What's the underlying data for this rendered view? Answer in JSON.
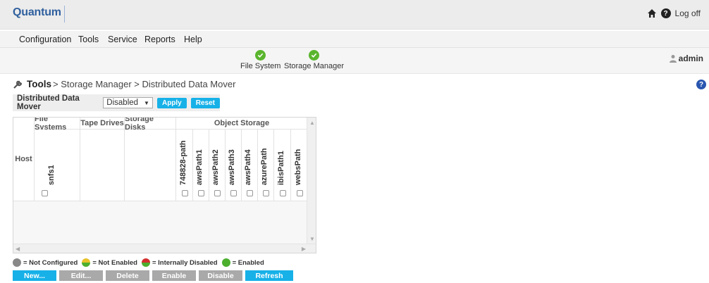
{
  "app": {
    "logo": "Quantum",
    "logoff": "Log off"
  },
  "menu": [
    "Configuration",
    "Tools",
    "Service",
    "Reports",
    "Help"
  ],
  "status": [
    {
      "label": "File System",
      "state": "ok"
    },
    {
      "label": "Storage Manager",
      "state": "ok"
    }
  ],
  "user": {
    "name": "admin"
  },
  "breadcrumb": {
    "root": "Tools",
    "path": "> Storage Manager > Distributed Data Mover"
  },
  "ddm": {
    "label": "Distributed Data Mover",
    "value": "Disabled",
    "apply": "Apply",
    "reset": "Reset"
  },
  "table": {
    "host_header": "Host",
    "group_headers": [
      "File Systems",
      "Tape Drives",
      "Storage Disks",
      "Object Storage"
    ],
    "file_systems": [
      "snfs1"
    ],
    "object_storage": [
      "748828-path",
      "awsPath1",
      "awsPath2",
      "awsPath3",
      "awsPath4",
      "azurePath",
      "ibisPath1",
      "websPath"
    ]
  },
  "legend": [
    "= Not Configured",
    "= Not Enabled",
    "= Internally Disabled",
    "= Enabled"
  ],
  "buttons": {
    "new": "New...",
    "edit": "Edit...",
    "delete": "Delete",
    "enable": "Enable",
    "disable": "Disable",
    "refresh": "Refresh"
  },
  "colors": {
    "accent": "#17b1e8",
    "ok": "#5ab52e",
    "brand": "#2f5f9e"
  }
}
